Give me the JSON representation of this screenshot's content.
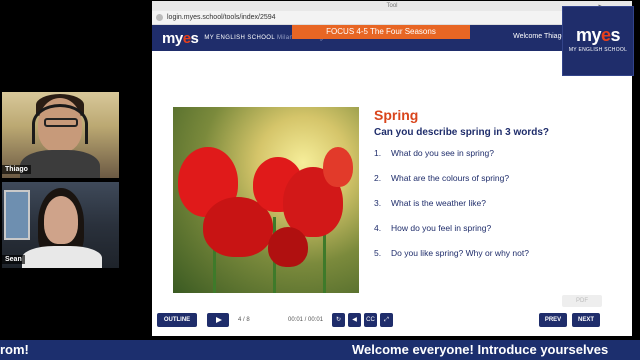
{
  "participants": [
    {
      "name": "Thiago"
    },
    {
      "name": "Sean"
    }
  ],
  "browser": {
    "title": "Tool",
    "url": "login.myes.school/tools/index/2594"
  },
  "header": {
    "logo": "myes",
    "logo_sub": "MY ENGLISH SCHOOL",
    "logo_sub2": "Milano Meravigli",
    "focus": "FOCUS 4-5 The Four Seasons",
    "welcome": "Welcome Thiago Brand"
  },
  "slide": {
    "title": "Spring",
    "subtitle": "Can you describe spring in 3 words?",
    "questions": [
      {
        "num": "1.",
        "text": "What do you see in spring?"
      },
      {
        "num": "2.",
        "text": "What are the colours of spring?"
      },
      {
        "num": "3.",
        "text": "What is the weather like?"
      },
      {
        "num": "4.",
        "text": "How do you feel in spring?"
      },
      {
        "num": "5.",
        "text": "Do you like spring? Why or why not?"
      }
    ]
  },
  "controls": {
    "outline": "OUTLINE",
    "page": "4 / 8",
    "time": "00:01 / 00:01",
    "cc": "CC",
    "prev": "PREV",
    "next": "NEXT",
    "pdf": "PDF"
  },
  "corner_logo": {
    "big": "myes",
    "small": "MY ENGLISH SCHOOL"
  },
  "ticker": {
    "left": "rom!",
    "right": "Welcome everyone! Introduce yourselves"
  },
  "colors": {
    "brand": "#1f2d6b",
    "accent": "#e86624",
    "title": "#d9451c"
  }
}
